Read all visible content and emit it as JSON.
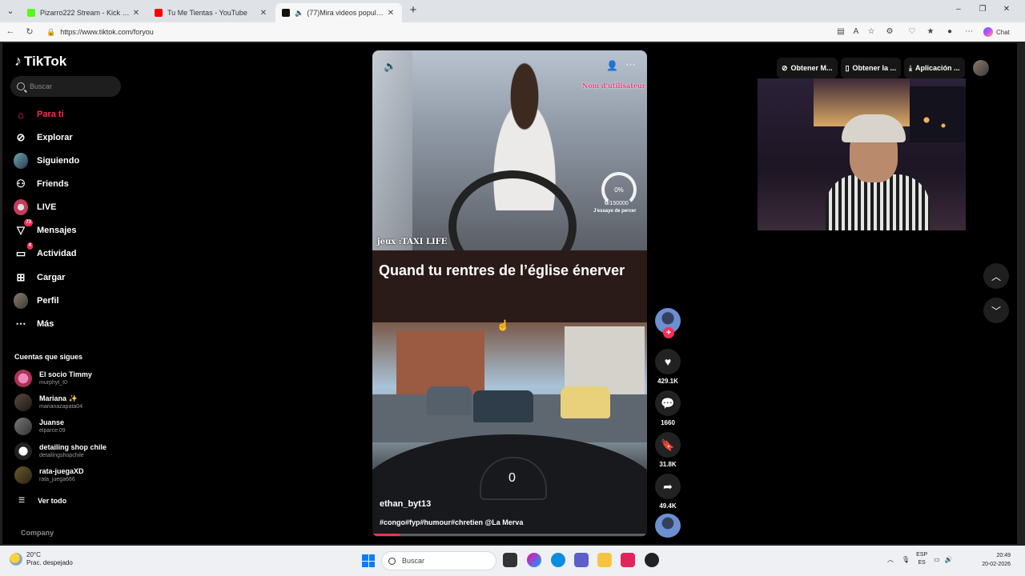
{
  "browser": {
    "tabs": [
      {
        "title": "Pizarro222 Stream - Kick Dashboard",
        "color": "#53fc18",
        "active": false
      },
      {
        "title": "Tu Me Tientas - YouTube",
        "color": "#ff0000",
        "active": false
      },
      {
        "title": "(77)Mira videos populares sobre...",
        "color": "#111111",
        "active": true
      }
    ],
    "url": "https://www.tiktok.com/foryou",
    "chat_label": "Chat"
  },
  "sidebar": {
    "brand": "TikTok",
    "search_placeholder": "Buscar",
    "nav": [
      {
        "label": "Para ti",
        "icon": "home-icon",
        "active": true
      },
      {
        "label": "Explorar",
        "icon": "compass-icon"
      },
      {
        "label": "Siguiendo",
        "icon": "following-avatar"
      },
      {
        "label": "Friends",
        "icon": "friends-icon"
      },
      {
        "label": "LIVE",
        "icon": "live-icon"
      },
      {
        "label": "Mensajes",
        "icon": "messages-icon",
        "badge": "73"
      },
      {
        "label": "Actividad",
        "icon": "activity-icon",
        "badge": "4"
      },
      {
        "label": "Cargar",
        "icon": "upload-icon"
      },
      {
        "label": "Perfil",
        "icon": "profile-avatar"
      },
      {
        "label": "Más",
        "icon": "more-icon"
      }
    ],
    "following_title": "Cuentas que sigues",
    "following": [
      {
        "name": "El socio Timmy",
        "handle": "murphyt_t0"
      },
      {
        "name": "Mariana ✨",
        "handle": "marianazapata04"
      },
      {
        "name": "Juanse",
        "handle": "elparce.09"
      },
      {
        "name": "detailing shop chile",
        "handle": "detailingshopchile"
      },
      {
        "name": "rata-juegaXD",
        "handle": "rata_juega666"
      }
    ],
    "see_all": "Ver todo",
    "company": "Company"
  },
  "video": {
    "overlay_game": "jeux :TAXI LIFE",
    "overlay_user": "Nom d'utilisateur",
    "gauge_percent": "0%",
    "gauge_value": "0",
    "gauge_total": "/150000",
    "gauge_label": "J'essaye de percer",
    "caption": "Quand tu rentres de l’église énerver",
    "speed": "0",
    "author": "ethan_byt13",
    "description": "#congo#fyp#humour#chretien @La Merva",
    "progress": 0.1,
    "notif_count": "1"
  },
  "actions": {
    "likes": "429.1K",
    "comments": "1660",
    "saves": "31.8K",
    "shares": "49.4K"
  },
  "header_actions": [
    {
      "label": "Obtener M...",
      "icon": "coin-icon"
    },
    {
      "label": "Obtener la ...",
      "icon": "phone-icon"
    },
    {
      "label": "Aplicación ...",
      "icon": "download-icon"
    }
  ],
  "taskbar": {
    "temp": "20°C",
    "weather": "Prac. despejado",
    "search_placeholder": "Buscar",
    "lang_top": "ESP",
    "lang_bottom": "ES",
    "time": "20:49",
    "date": "20-02-2026"
  }
}
